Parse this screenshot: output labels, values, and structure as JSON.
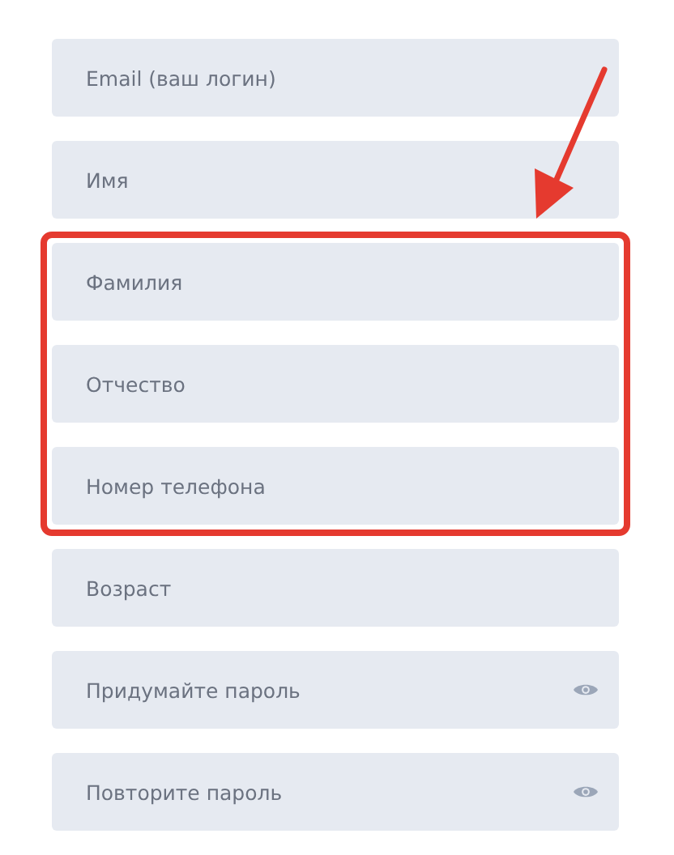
{
  "fields": [
    {
      "kind": "text",
      "placeholder": "Email (ваш логин)",
      "highlighted": false
    },
    {
      "kind": "text",
      "placeholder": "Имя",
      "highlighted": false
    },
    {
      "kind": "text",
      "placeholder": "Фамилия",
      "highlighted": true
    },
    {
      "kind": "text",
      "placeholder": "Отчество",
      "highlighted": true
    },
    {
      "kind": "text",
      "placeholder": "Номер телефона",
      "highlighted": true
    },
    {
      "kind": "text",
      "placeholder": "Возраст",
      "highlighted": false
    },
    {
      "kind": "password",
      "placeholder": "Придумайте пароль",
      "highlighted": false
    },
    {
      "kind": "password",
      "placeholder": "Повторите пароль",
      "highlighted": false
    }
  ]
}
